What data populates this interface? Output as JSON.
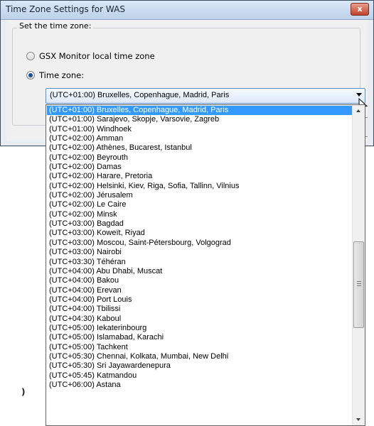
{
  "window": {
    "title": "Time Zone Settings for WAS",
    "close_label": "x"
  },
  "group": {
    "label": "Set the time zone:"
  },
  "radios": [
    {
      "label": "GSX Monitor local time zone",
      "checked": false
    },
    {
      "label": "Time zone:",
      "checked": true
    }
  ],
  "combo": {
    "value": "(UTC+01:00) Bruxelles, Copenhague, Madrid, Paris"
  },
  "background_glyph": ")",
  "dropdown": {
    "selected_index": 0,
    "items": [
      "(UTC+01:00) Bruxelles, Copenhague, Madrid, Paris",
      "(UTC+01:00) Sarajevo, Skopje, Varsovie, Zagreb",
      "(UTC+01:00) Windhoek",
      "(UTC+02:00) Amman",
      "(UTC+02:00) Athènes, Bucarest, Istanbul",
      "(UTC+02:00) Beyrouth",
      "(UTC+02:00) Damas",
      "(UTC+02:00) Harare, Pretoria",
      "(UTC+02:00) Helsinki, Kiev, Riga, Sofia, Tallinn, Vilnius",
      "(UTC+02:00) Jérusalem",
      "(UTC+02:00) Le Caire",
      "(UTC+02:00) Minsk",
      "(UTC+03:00) Bagdad",
      "(UTC+03:00) Koweït, Riyad",
      "(UTC+03:00) Moscou, Saint-Pétersbourg, Volgograd",
      "(UTC+03:00) Nairobi",
      "(UTC+03:30) Téhéran",
      "(UTC+04:00) Abu Dhabi, Muscat",
      "(UTC+04:00) Bakou",
      "(UTC+04:00) Erevan",
      "(UTC+04:00) Port Louis",
      "(UTC+04:00) Tbilissi",
      "(UTC+04:30) Kaboul",
      "(UTC+05:00) Iekaterinbourg",
      "(UTC+05:00) Islamabad, Karachi",
      "(UTC+05:00) Tachkent",
      "(UTC+05:30) Chennai, Kolkata, Mumbai, New Delhi",
      "(UTC+05:30) Sri Jayawardenepura",
      "(UTC+05:45) Katmandou",
      "(UTC+06:00) Astana"
    ]
  }
}
